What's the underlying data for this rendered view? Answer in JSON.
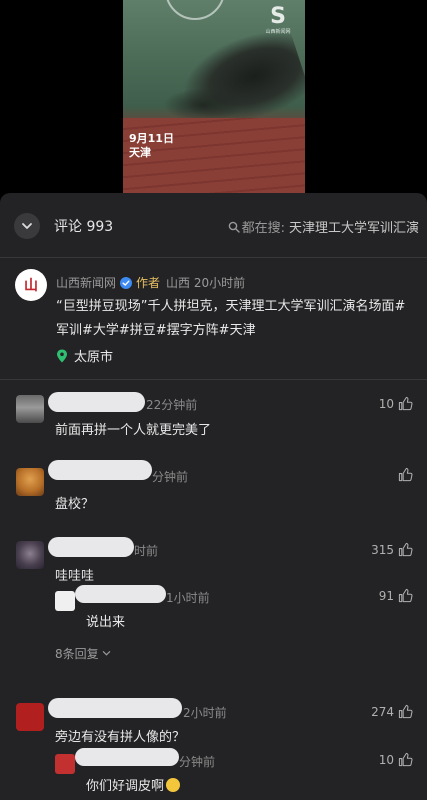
{
  "video": {
    "date_line1": "9月11日",
    "date_line2": "天津",
    "logo_sub": "山西新闻网"
  },
  "header": {
    "comments_label": "评论 993",
    "search_prefix": "都在搜:",
    "search_query": "天津理工大学军训汇演"
  },
  "post": {
    "avatar_text": "山",
    "account": "山西新闻网",
    "author_tag": "作者",
    "location_time": "山西 20小时前",
    "text": "“巨型拼豆现场”千人拼坦克，天津理工大学军训汇演名场面#军训#大学#拼豆#摆字方阵#天津",
    "location": "太原市"
  },
  "comments": [
    {
      "time": "22分钟前",
      "text": "前面再拼一个人就更完美了",
      "likes": "10"
    },
    {
      "time": "分钟前",
      "text": "盘校？",
      "likes": ""
    },
    {
      "time": "时前",
      "text": "哇哇哇",
      "likes": "315",
      "reply": {
        "time": "1小时前",
        "text": "说出来",
        "likes": "91"
      },
      "more_replies": "8条回复"
    },
    {
      "time": "2小时前",
      "text": "旁边有没有拼人像的？",
      "likes": "274",
      "reply": {
        "time": "分钟前",
        "text": "你们好调皮啊",
        "likes": "10"
      }
    }
  ],
  "colors": {
    "sheet_bg": "#232325",
    "author_tag": "#e8c064",
    "verified": "#3d8bf2",
    "text": "#e8e8e8",
    "muted": "#8a8a8a"
  }
}
